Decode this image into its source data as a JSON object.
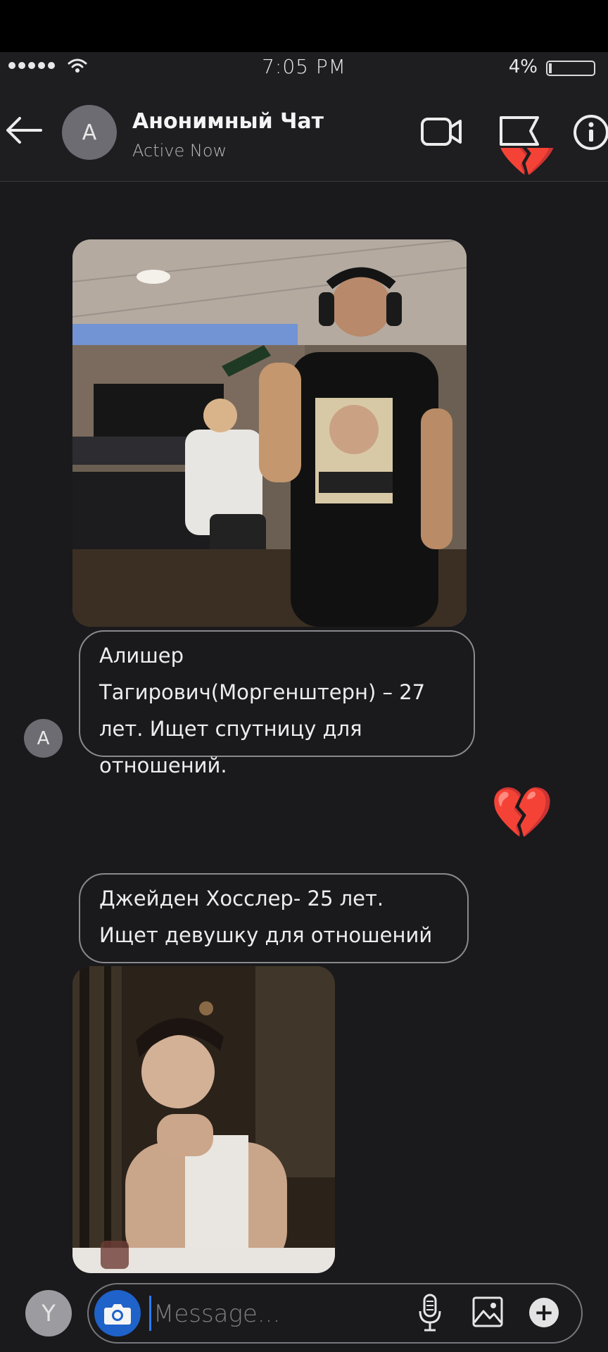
{
  "status_bar": {
    "time": "7:05 PM",
    "battery": "4%"
  },
  "header": {
    "avatar_letter": "A",
    "title": "Анонимный Чат",
    "subtitle": "Active Now"
  },
  "messages": [
    {
      "type": "image",
      "alt": "photo"
    },
    {
      "type": "text",
      "text": "Алишер Тагирович(Моргенштерн) – 27 лет. Ищет спутницу для отношений.",
      "avatar_letter": "A"
    },
    {
      "type": "reaction",
      "emoji": "💔"
    },
    {
      "type": "text",
      "text": "Джейден Хосслер- 25 лет. Ищет девушку для отношений"
    },
    {
      "type": "image",
      "alt": "photo"
    }
  ],
  "reaction_top": "💔",
  "composer": {
    "avatar_letter": "Y",
    "placeholder": "Message..."
  },
  "icons": {
    "back": "back-arrow-icon",
    "video": "video-camera-icon",
    "report": "flag-icon",
    "info": "info-icon",
    "camera": "camera-icon",
    "mic": "microphone-icon",
    "gallery": "image-icon",
    "add": "plus-icon"
  },
  "colors": {
    "background": "#1a191c",
    "accent": "#1f62c9",
    "bubble_border": "#8a898e"
  }
}
